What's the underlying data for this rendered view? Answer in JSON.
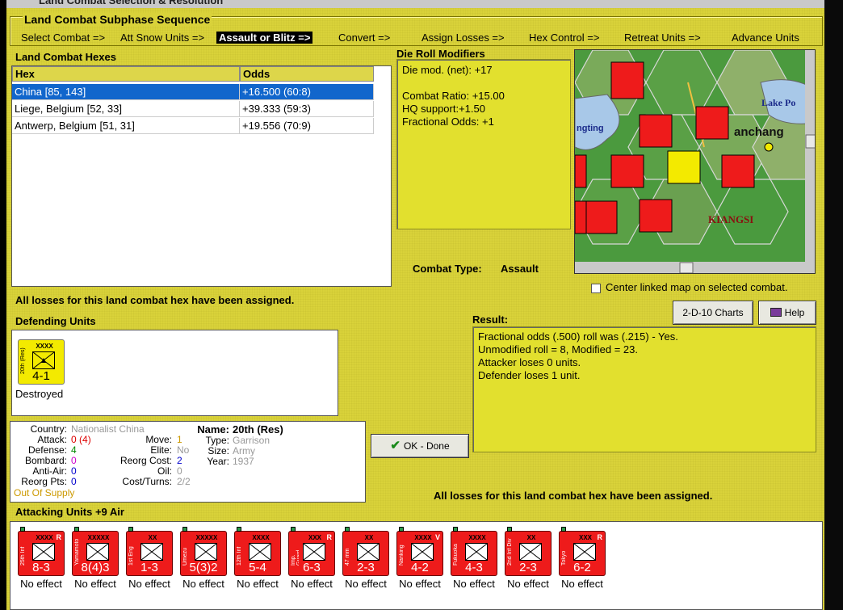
{
  "window": {
    "title": "Land Combat Selection & Resolution"
  },
  "phase": {
    "title": "Land Combat Subphase Sequence",
    "steps": [
      "Select Combat =>",
      "Att Snow Units =>",
      "Assault or Blitz =>",
      "Convert =>",
      "Assign Losses =>",
      "Hex Control =>",
      "Retreat Units =>",
      "Advance Units"
    ],
    "active_index": 2
  },
  "hexes": {
    "title": "Land Combat Hexes",
    "headers": [
      "Hex",
      "Odds"
    ],
    "rows": [
      {
        "hex": "China [85, 143]",
        "odds": "+16.500 (60:8)"
      },
      {
        "hex": "Liege, Belgium [52, 33]",
        "odds": "+39.333 (59:3)"
      },
      {
        "hex": "Antwerp, Belgium [51, 31]",
        "odds": "+19.556 (70:9)"
      }
    ],
    "selected_index": 0
  },
  "die_roll": {
    "title": "Die Roll Modifiers",
    "lines": [
      "Die mod. (net): +17",
      "",
      "Combat Ratio: +15.00",
      "HQ support:+1.50",
      "Fractional Odds: +1"
    ]
  },
  "combat_type": {
    "label": "Combat Type:",
    "value": "Assault"
  },
  "map": {
    "labels": {
      "lake": "Lake Po",
      "city": "anchang",
      "province": "KIANGSI",
      "west": "ngting"
    }
  },
  "center_map": {
    "label": "Center linked map on selected combat.",
    "checked": false
  },
  "buttons": {
    "charts": "2-D-10 Charts",
    "help": "Help",
    "ok": "OK - Done"
  },
  "losses_msg": "All losses for this land combat hex have been assigned.",
  "result": {
    "title": "Result:",
    "lines": [
      "Fractional odds (.500) roll was (.215)  - Yes.",
      "Unmodified roll = 8, Modified = 23.",
      "Attacker loses 0 units.",
      "Defender loses 1 unit."
    ]
  },
  "defending": {
    "title": "Defending Units",
    "units": [
      {
        "name": "20th (Res)",
        "size": "XXXX",
        "strength": "4-1",
        "status": "Destroyed",
        "color": "#f3ea00"
      }
    ]
  },
  "unit_info": {
    "country_label": "Country:",
    "country": "Nationalist China",
    "attack_label": "Attack:",
    "attack": "0",
    "attack_mod": "(4)",
    "defense_label": "Defense:",
    "defense": "4",
    "bombard_label": "Bombard:",
    "bombard": "0",
    "antiair_label": "Anti-Air:",
    "antiair": "0",
    "reorg_label": "Reorg Pts:",
    "reorg": "0",
    "supply": "Out Of Supply",
    "move_label": "Move:",
    "move": "1",
    "elite_label": "Elite:",
    "elite": "No",
    "reorg_cost_label": "Reorg Cost:",
    "reorg_cost": "2",
    "oil_label": "Oil:",
    "oil": "0",
    "cost_turns_label": "Cost/Turns:",
    "cost_turns": "2/2",
    "name_label": "Name:",
    "name": "20th (Res)",
    "type_label": "Type:",
    "type": "Garrison",
    "size_label": "Size:",
    "size": "Army",
    "year_label": "Year:",
    "year": "1937"
  },
  "attacking": {
    "title": "Attacking Units +9 Air",
    "units": [
      {
        "name": "25th Inf",
        "size": "XXXX",
        "strength": "8-3",
        "flag": "R",
        "effect": "No effect"
      },
      {
        "name": "Yamamoto",
        "size": "XXXXX",
        "strength": "8(4)3",
        "flag": "",
        "effect": "No effect"
      },
      {
        "name": "1st Eng",
        "size": "XX",
        "strength": "1-3",
        "flag": "",
        "effect": "No effect"
      },
      {
        "name": "Umezu",
        "size": "XXXXX",
        "strength": "5(3)2",
        "flag": "",
        "effect": "No effect"
      },
      {
        "name": "12th Inf",
        "size": "XXXX",
        "strength": "5-4",
        "flag": "",
        "effect": "No effect"
      },
      {
        "name": "Imp. Guard",
        "size": "XXX",
        "strength": "6-3",
        "flag": "R",
        "effect": "No effect"
      },
      {
        "name": "47 mm",
        "size": "XX",
        "strength": "2-3",
        "flag": "",
        "effect": "No effect"
      },
      {
        "name": "Nanking",
        "size": "XXXX",
        "strength": "4-2",
        "flag": "V",
        "effect": "No effect"
      },
      {
        "name": "Fukuoka",
        "size": "XXXX",
        "strength": "4-3",
        "flag": "",
        "effect": "No effect"
      },
      {
        "name": "2nd Inf Div",
        "size": "XX",
        "strength": "2-3",
        "flag": "",
        "effect": "No effect"
      },
      {
        "name": "Tokyo",
        "size": "XXX",
        "strength": "6-2",
        "flag": "R",
        "effect": "No effect"
      }
    ]
  },
  "colors": {
    "panel_yellow": "#d9d23a",
    "counter_red": "#ee1b1b",
    "select_blue": "#1166cc"
  }
}
